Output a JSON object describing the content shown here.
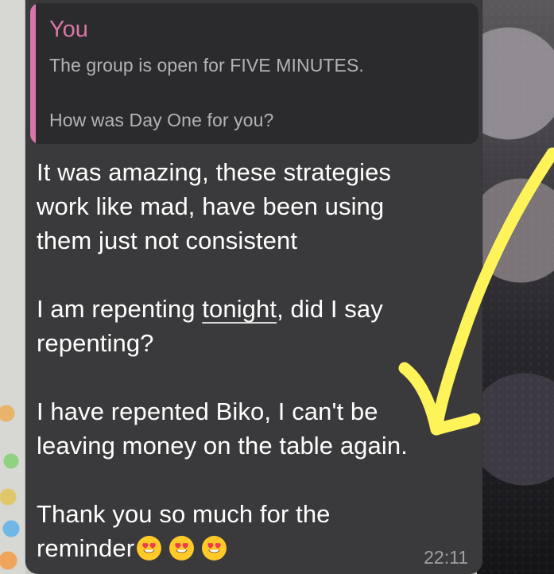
{
  "quote": {
    "author": "You",
    "line1": "The group is open for FIVE MINUTES.",
    "line2": "How was Day One for you?"
  },
  "message": {
    "line1": "It was amazing, these strategies",
    "line2": "work like mad, have been using",
    "line3": "them just not consistent",
    "line4_prefix": "I am repenting ",
    "line4_link": "tonight",
    "line4_suffix": ", did I say",
    "line5": "repenting?",
    "line6": "I have repented Biko, I can't be",
    "line7": "leaving money on the table again.",
    "line8": "Thank you so much for the",
    "line9": "reminder"
  },
  "timestamp": "22:11",
  "icons": {
    "emoji": "heart-eyes-emoji",
    "annotation": "yellow-arrow-annotation"
  },
  "colors": {
    "bubble": "#3a3a3c",
    "quote_background": "#2b2b2d",
    "quote_accent": "#d777a8",
    "text": "#ffffff",
    "muted": "#9fa0a4",
    "arrow": "#fff35a"
  }
}
